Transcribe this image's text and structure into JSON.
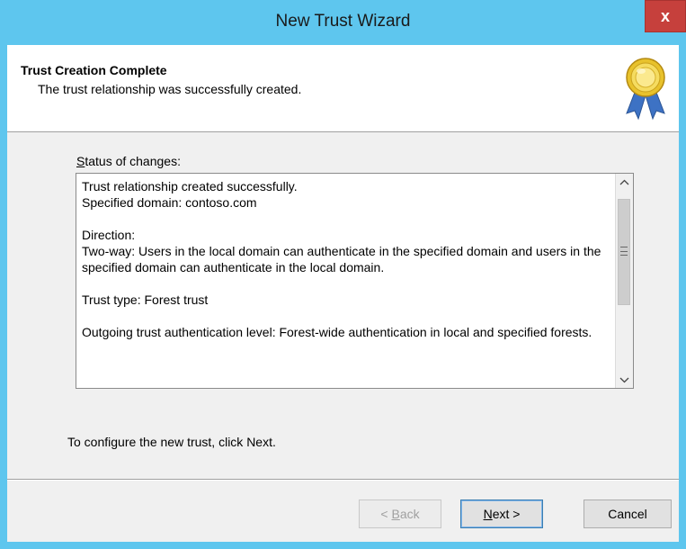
{
  "window": {
    "title": "New Trust Wizard",
    "close_glyph": "x"
  },
  "header": {
    "title": "Trust Creation Complete",
    "subtitle": "The trust relationship was successfully created.",
    "icon": "award-medal-icon"
  },
  "status": {
    "label_prefix": "S",
    "label_rest": "tatus of changes:",
    "text": "Trust relationship created successfully.\nSpecified domain: contoso.com\n\nDirection:\nTwo-way: Users in the local domain can authenticate in the specified domain and users in the specified domain can authenticate in the local domain.\n\nTrust type: Forest trust\n\nOutgoing trust authentication level: Forest-wide authentication in local and specified forests."
  },
  "instruction": "To configure the new trust, click Next.",
  "buttons": {
    "back_prefix": "< ",
    "back_accel": "B",
    "back_rest": "ack",
    "next_accel": "N",
    "next_rest": "ext >",
    "cancel": "Cancel"
  },
  "colors": {
    "titlebar": "#5ec6ee",
    "close": "#c6403c",
    "client": "#f0f0f0"
  }
}
